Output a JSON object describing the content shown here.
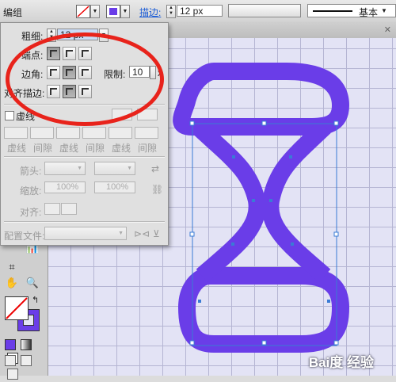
{
  "topbar": {
    "group_label": "编组",
    "stroke_link": "描边:",
    "stroke_weight": "12 px",
    "line_style": "基本",
    "colors": {
      "stroke_swatch": "#ffffff",
      "fill_swatch": "#6a3de8"
    }
  },
  "panel": {
    "weight_label": "粗细:",
    "weight_value": "12 px",
    "cap_label": "端点:",
    "corner_label": "边角:",
    "limit_label": "限制:",
    "limit_value": "10",
    "limit_unit": "x",
    "align_label": "对齐描边:",
    "dashed_label": "虚线",
    "dash_labels": [
      "虚线",
      "间隙",
      "虚线",
      "间隙",
      "虚线",
      "间隙"
    ],
    "arrow_label": "箭头:",
    "scale_label": "缩放:",
    "scale_start": "100%",
    "scale_end": "100%",
    "align_arrow_label": "对齐:",
    "profile_label": "配置文件:"
  },
  "canvas": {
    "shape_color": "#6a3de8",
    "grid_color": "#b5b5d3",
    "background": "#e3e3f5",
    "watermark": "Bai度 经验"
  },
  "icons": [
    "hand-icon",
    "zoom-icon",
    "swap-icon",
    "artboard-icon",
    "chart-icon"
  ]
}
